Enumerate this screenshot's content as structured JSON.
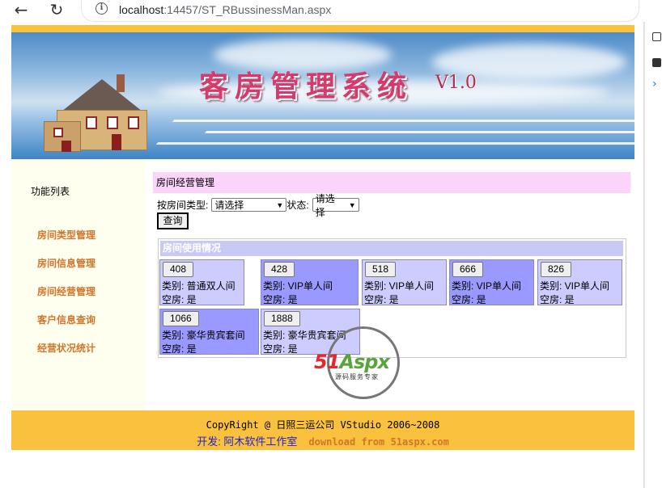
{
  "browser": {
    "url_host": "localhost",
    "url_rest": ":14457/ST_RBussinessMan.aspx"
  },
  "banner": {
    "title": "客房管理系统",
    "version": "V1.0"
  },
  "sidebar": {
    "title": "功能列表",
    "items": [
      {
        "label": "房间类型管理"
      },
      {
        "label": "房间信息管理"
      },
      {
        "label": "房间经营管理"
      },
      {
        "label": "客户信息查询"
      },
      {
        "label": "经营状况统计"
      }
    ]
  },
  "main": {
    "section_title": "房间经营管理",
    "filter": {
      "type_label": "按房间类型:",
      "type_value": "请选择",
      "status_label": "状态:",
      "status_value": "请选择",
      "query_label": "查询"
    },
    "rooms_title": "房间使用情况",
    "rooms": [
      {
        "number": "408",
        "type": "类别: 普通双人间",
        "vacant": "空房:  是"
      },
      {
        "number": "428",
        "type": "类别: VIP单人间",
        "vacant": "空房:  是"
      },
      {
        "number": "518",
        "type": "类别: VIP单人间",
        "vacant": "空房:  是"
      },
      {
        "number": "666",
        "type": "类别: VIP单人间",
        "vacant": "空房:  是"
      },
      {
        "number": "826",
        "type": "类别: VIP单人间",
        "vacant": "空房:  是"
      },
      {
        "number": "1066",
        "type": "类别: 豪华贵宾套间",
        "vacant": "空房:  是"
      },
      {
        "number": "1888",
        "type": "类别: 豪华贵宾套间",
        "vacant": "空房:  是"
      }
    ]
  },
  "watermark": {
    "brand_51": "51",
    "brand_aspx": "Aspx",
    "slogan": "源码服务专家"
  },
  "footer": {
    "copyright": "CopyRight @ 日照三运公司 VStudio 2006~2008",
    "dev_label": "开发: 阿木软件工作室",
    "download": "download from 51aspx.com"
  },
  "colors": {
    "accent": "#f9c13e",
    "section_head": "#fbd3fb",
    "room_light": "#ccccff",
    "room_dark": "#9999ff",
    "link": "#d0752b"
  }
}
